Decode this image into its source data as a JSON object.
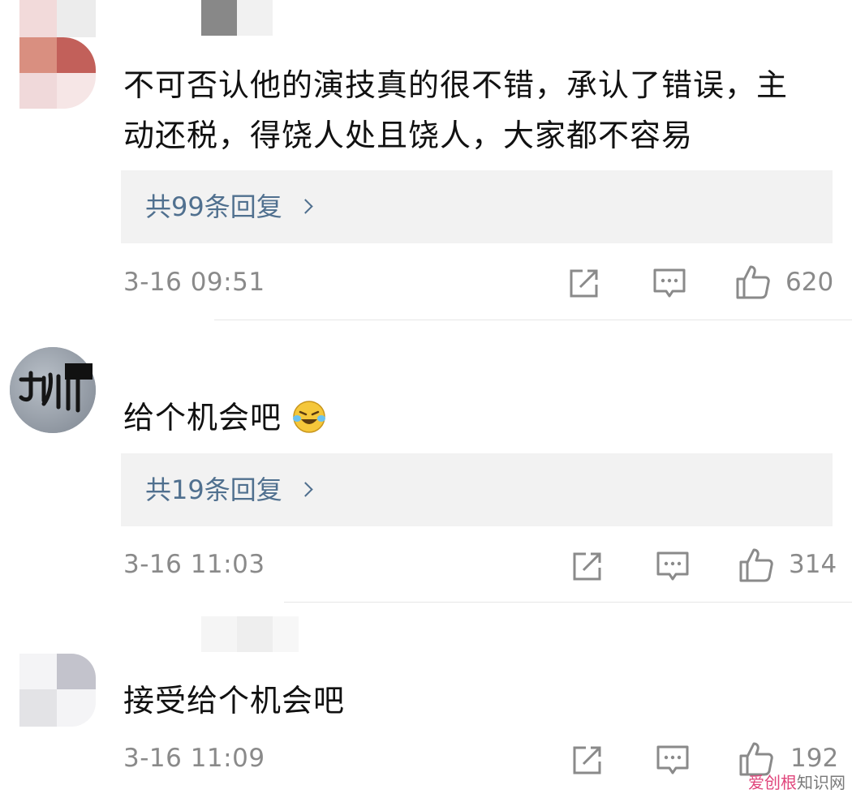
{
  "comments": [
    {
      "text_line1": "不可否认他的演技真的很不错，承认了错误，主",
      "text_line2": "动还税，得饶人处且饶人，大家都不容易",
      "replies_label": "共99条回复",
      "time": "3-16 09:51",
      "likes": "620"
    },
    {
      "text": "给个机会吧",
      "emoji": "laughing-crying-emoji",
      "replies_label": "共19条回复",
      "time": "3-16 11:03",
      "likes": "314"
    },
    {
      "text": "接受给个机会吧",
      "time": "3-16 11:09",
      "likes": "192"
    }
  ],
  "icons": {
    "share": "share-icon",
    "comment": "comment-icon",
    "like": "thumbs-up-icon"
  },
  "colors": {
    "reply_link": "#50708f",
    "meta_gray": "#8a8a8a",
    "reply_bg": "#f2f2f2"
  },
  "watermark": {
    "part1": "爱创根",
    "part2": "知识网"
  }
}
